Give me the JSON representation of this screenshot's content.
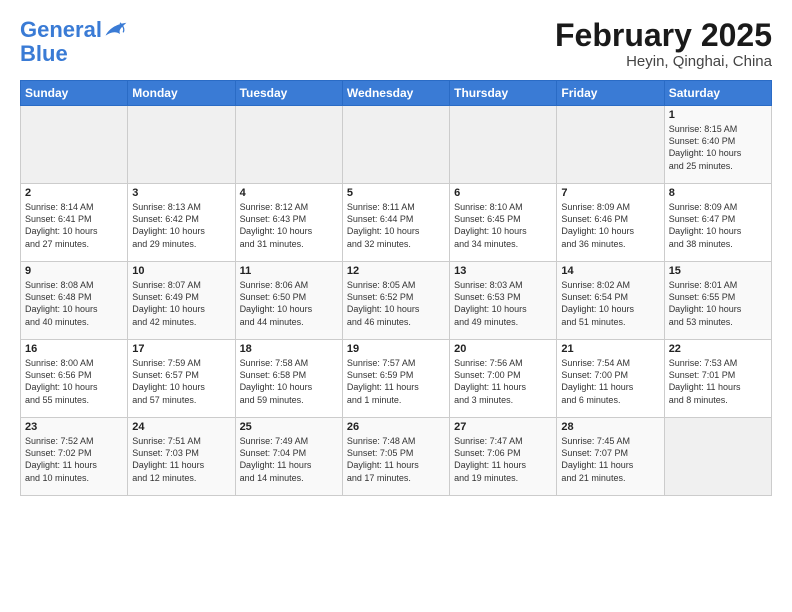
{
  "logo": {
    "line1": "General",
    "line2": "Blue"
  },
  "title": "February 2025",
  "subtitle": "Heyin, Qinghai, China",
  "days_of_week": [
    "Sunday",
    "Monday",
    "Tuesday",
    "Wednesday",
    "Thursday",
    "Friday",
    "Saturday"
  ],
  "weeks": [
    [
      {
        "day": "",
        "info": ""
      },
      {
        "day": "",
        "info": ""
      },
      {
        "day": "",
        "info": ""
      },
      {
        "day": "",
        "info": ""
      },
      {
        "day": "",
        "info": ""
      },
      {
        "day": "",
        "info": ""
      },
      {
        "day": "1",
        "info": "Sunrise: 8:15 AM\nSunset: 6:40 PM\nDaylight: 10 hours\nand 25 minutes."
      }
    ],
    [
      {
        "day": "2",
        "info": "Sunrise: 8:14 AM\nSunset: 6:41 PM\nDaylight: 10 hours\nand 27 minutes."
      },
      {
        "day": "3",
        "info": "Sunrise: 8:13 AM\nSunset: 6:42 PM\nDaylight: 10 hours\nand 29 minutes."
      },
      {
        "day": "4",
        "info": "Sunrise: 8:12 AM\nSunset: 6:43 PM\nDaylight: 10 hours\nand 31 minutes."
      },
      {
        "day": "5",
        "info": "Sunrise: 8:11 AM\nSunset: 6:44 PM\nDaylight: 10 hours\nand 32 minutes."
      },
      {
        "day": "6",
        "info": "Sunrise: 8:10 AM\nSunset: 6:45 PM\nDaylight: 10 hours\nand 34 minutes."
      },
      {
        "day": "7",
        "info": "Sunrise: 8:09 AM\nSunset: 6:46 PM\nDaylight: 10 hours\nand 36 minutes."
      },
      {
        "day": "8",
        "info": "Sunrise: 8:09 AM\nSunset: 6:47 PM\nDaylight: 10 hours\nand 38 minutes."
      }
    ],
    [
      {
        "day": "9",
        "info": "Sunrise: 8:08 AM\nSunset: 6:48 PM\nDaylight: 10 hours\nand 40 minutes."
      },
      {
        "day": "10",
        "info": "Sunrise: 8:07 AM\nSunset: 6:49 PM\nDaylight: 10 hours\nand 42 minutes."
      },
      {
        "day": "11",
        "info": "Sunrise: 8:06 AM\nSunset: 6:50 PM\nDaylight: 10 hours\nand 44 minutes."
      },
      {
        "day": "12",
        "info": "Sunrise: 8:05 AM\nSunset: 6:52 PM\nDaylight: 10 hours\nand 46 minutes."
      },
      {
        "day": "13",
        "info": "Sunrise: 8:03 AM\nSunset: 6:53 PM\nDaylight: 10 hours\nand 49 minutes."
      },
      {
        "day": "14",
        "info": "Sunrise: 8:02 AM\nSunset: 6:54 PM\nDaylight: 10 hours\nand 51 minutes."
      },
      {
        "day": "15",
        "info": "Sunrise: 8:01 AM\nSunset: 6:55 PM\nDaylight: 10 hours\nand 53 minutes."
      }
    ],
    [
      {
        "day": "16",
        "info": "Sunrise: 8:00 AM\nSunset: 6:56 PM\nDaylight: 10 hours\nand 55 minutes."
      },
      {
        "day": "17",
        "info": "Sunrise: 7:59 AM\nSunset: 6:57 PM\nDaylight: 10 hours\nand 57 minutes."
      },
      {
        "day": "18",
        "info": "Sunrise: 7:58 AM\nSunset: 6:58 PM\nDaylight: 10 hours\nand 59 minutes."
      },
      {
        "day": "19",
        "info": "Sunrise: 7:57 AM\nSunset: 6:59 PM\nDaylight: 11 hours\nand 1 minute."
      },
      {
        "day": "20",
        "info": "Sunrise: 7:56 AM\nSunset: 7:00 PM\nDaylight: 11 hours\nand 3 minutes."
      },
      {
        "day": "21",
        "info": "Sunrise: 7:54 AM\nSunset: 7:00 PM\nDaylight: 11 hours\nand 6 minutes."
      },
      {
        "day": "22",
        "info": "Sunrise: 7:53 AM\nSunset: 7:01 PM\nDaylight: 11 hours\nand 8 minutes."
      }
    ],
    [
      {
        "day": "23",
        "info": "Sunrise: 7:52 AM\nSunset: 7:02 PM\nDaylight: 11 hours\nand 10 minutes."
      },
      {
        "day": "24",
        "info": "Sunrise: 7:51 AM\nSunset: 7:03 PM\nDaylight: 11 hours\nand 12 minutes."
      },
      {
        "day": "25",
        "info": "Sunrise: 7:49 AM\nSunset: 7:04 PM\nDaylight: 11 hours\nand 14 minutes."
      },
      {
        "day": "26",
        "info": "Sunrise: 7:48 AM\nSunset: 7:05 PM\nDaylight: 11 hours\nand 17 minutes."
      },
      {
        "day": "27",
        "info": "Sunrise: 7:47 AM\nSunset: 7:06 PM\nDaylight: 11 hours\nand 19 minutes."
      },
      {
        "day": "28",
        "info": "Sunrise: 7:45 AM\nSunset: 7:07 PM\nDaylight: 11 hours\nand 21 minutes."
      },
      {
        "day": "",
        "info": ""
      }
    ]
  ]
}
